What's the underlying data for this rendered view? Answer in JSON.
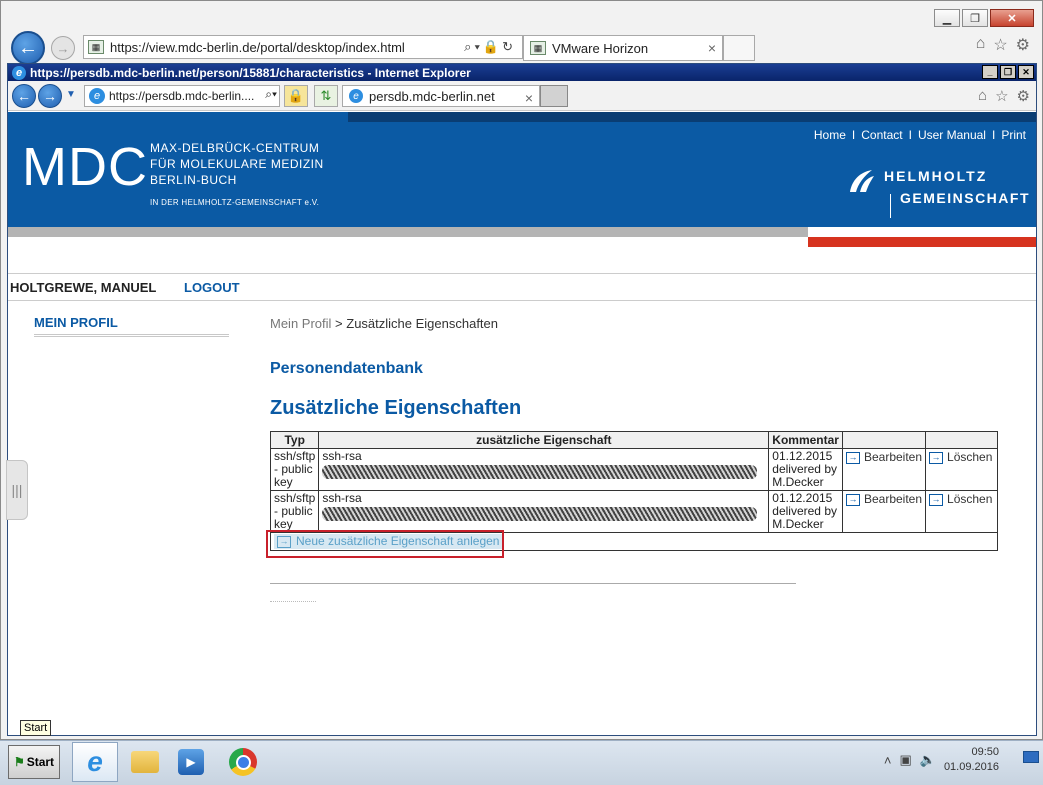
{
  "outer_browser": {
    "address": "https://view.mdc-berlin.de/portal/desktop/index.html",
    "tab_title": "VMware Horizon",
    "tab_close": "×"
  },
  "inner_browser": {
    "window_title": "https://persdb.mdc-berlin.net/person/15881/characteristics - Internet Explorer",
    "address": "https://persdb.mdc-berlin....",
    "tab_title": "persdb.mdc-berlin.net",
    "tab_close": "×"
  },
  "header": {
    "logo": "MDC",
    "org_lines": [
      "MAX-DELBRÜCK-CENTRUM",
      "FÜR MOLEKULARE MEDIZIN",
      "BERLIN-BUCH"
    ],
    "org_small": "IN DER HELMHOLTZ-GEMEINSCHAFT e.V.",
    "nav": [
      "Home",
      "Contact",
      "User Manual",
      "Print"
    ],
    "nav_sep": "I",
    "helmholtz_1": "HELMHOLTZ",
    "helmholtz_2": "GEMEINSCHAFT"
  },
  "userbar": {
    "user_name": "HOLTGREWE, MANUEL",
    "logout": "LOGOUT"
  },
  "sidebar": {
    "title": "MEIN PROFIL"
  },
  "breadcrumb": {
    "parent": "Mein Profil",
    "separator": " > ",
    "current": "Zusätzliche Eigenschaften"
  },
  "section_title": "Personendatenbank",
  "page_title": "Zusätzliche Eigenschaften",
  "table": {
    "headers": [
      "Typ",
      "zusätzliche Eigenschaft",
      "Kommentar",
      "",
      ""
    ],
    "rows": [
      {
        "typ": "ssh/sftp - public key",
        "eigenschaft": "ssh-rsa",
        "kommentar": "01.12.2015 delivered by M.Decker",
        "edit": "Bearbeiten",
        "delete": "Löschen"
      },
      {
        "typ": "ssh/sftp - public key",
        "eigenschaft": "ssh-rsa",
        "kommentar": "01.12.2015 delivered by M.Decker",
        "edit": "Bearbeiten",
        "delete": "Löschen"
      }
    ],
    "new_link": "Neue zusätzliche Eigenschaft anlegen"
  },
  "taskbar": {
    "start_tooltip": "Start",
    "start_label": "Start",
    "time": "09:50",
    "date": "01.09.2016"
  },
  "colors": {
    "brand_blue": "#0b5aa4",
    "helmholtz_red": "#d6331f",
    "highlight_red": "#c8202b"
  }
}
